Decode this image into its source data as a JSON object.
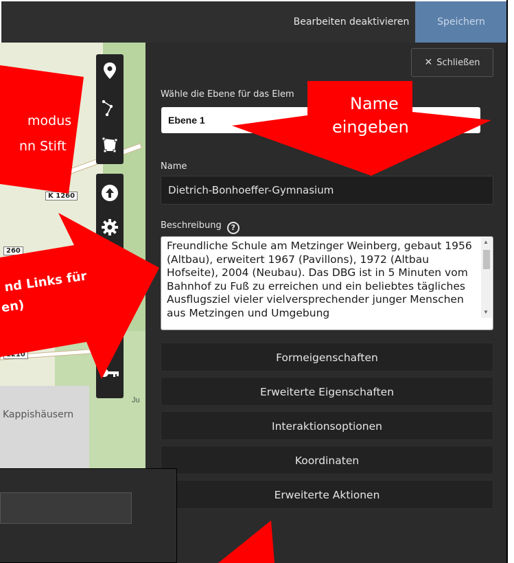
{
  "topbar": {
    "deactivate_label": "Bearbeiten deaktivieren",
    "save_label": "Speichern"
  },
  "map": {
    "road_labels": [
      "K 1260",
      "260",
      "1210"
    ],
    "place_label": "Kappishäusern",
    "edge_label": "Ju",
    "tools": [
      {
        "icon": "map-pin-icon"
      },
      {
        "icon": "polyline-icon"
      },
      {
        "icon": "polygon-icon"
      },
      {
        "icon": "upload-icon"
      },
      {
        "icon": "gear-icon"
      },
      {
        "icon": "key-icon"
      }
    ]
  },
  "panel": {
    "close_label": "Schließen",
    "layer_label": "Wähle die Ebene für das Elem",
    "layer_value": "Ebene 1",
    "name_label": "Name",
    "name_value": "Dietrich-Bonhoeffer-Gymnasium",
    "description_label": "Beschreibung",
    "description_value": "Freundliche Schule am Metzinger Weinberg, gebaut 1956 (Altbau), erweitert 1967 (Pavillons), 1972 (Altbau Hofseite), 2004 (Neubau). Das DBG ist in 5 Minuten vom Bahnhof zu Fuß zu erreichen und ein beliebtes tägliches Ausflugsziel vieler vielversprechender junger Menschen aus Metzingen und Umgebung",
    "sections": [
      "Formeigenschaften",
      "Erweiterte Eigenschaften",
      "Interaktionsoptionen",
      "Koordinaten",
      "Erweiterte Aktionen"
    ]
  },
  "callouts": {
    "left_top": [
      "modus",
      "nn Stift"
    ],
    "name_hint": [
      "Name",
      "eingeben"
    ],
    "links_hint": [
      "nd Links für",
      "en)"
    ]
  },
  "colors": {
    "annotation_red": "#ff0000",
    "panel_bg": "#2b2b2b",
    "save_button": "#5a7fa9"
  }
}
